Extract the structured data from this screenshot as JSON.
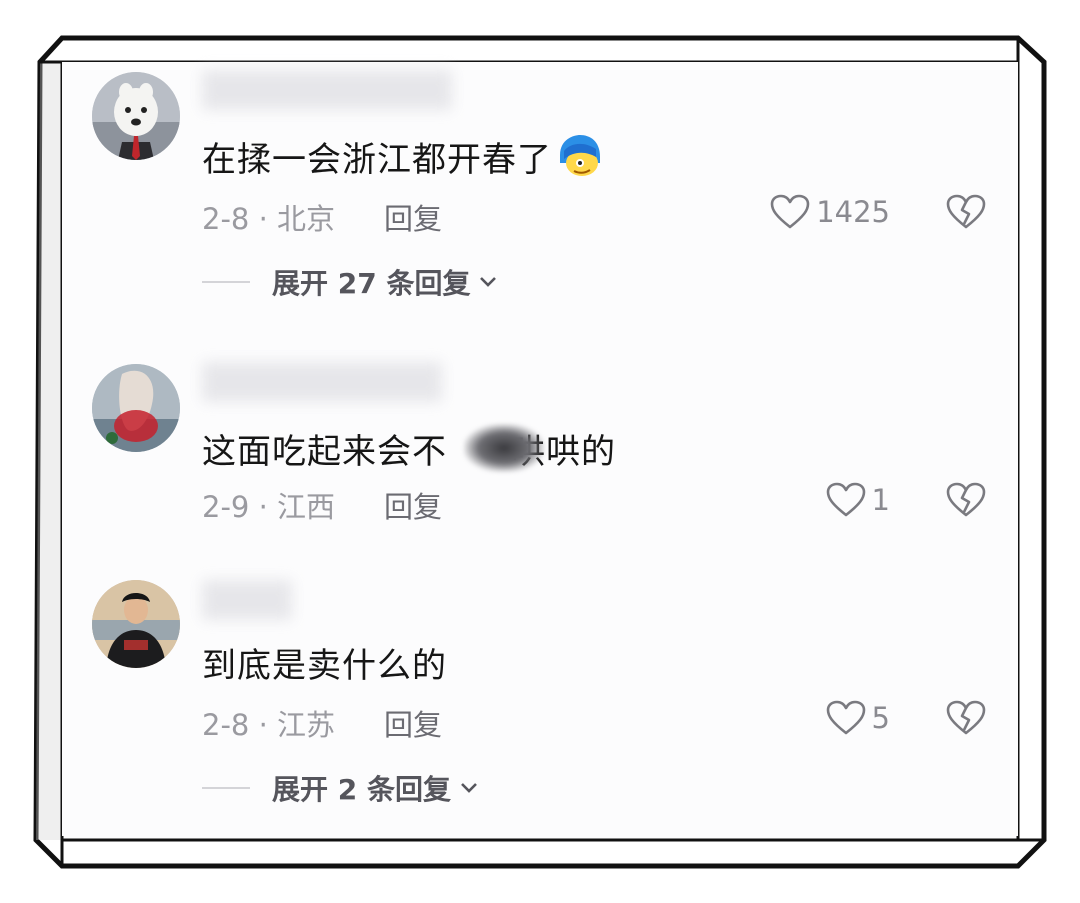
{
  "comments": [
    {
      "text": "在揉一会浙江都开春了",
      "date_loc": "2-8 · 北京",
      "reply_label": "回复",
      "likes": "1425",
      "expand_label": "展开 27 条回复"
    },
    {
      "text_before": "这面吃起来会不",
      "text_after": "哄哄的",
      "date_loc": "2-9 · 江西",
      "reply_label": "回复",
      "likes": "1"
    },
    {
      "text": "到底是卖什么的",
      "date_loc": "2-8 · 江苏",
      "reply_label": "回复",
      "likes": "5",
      "expand_label": "展开 2 条回复"
    }
  ],
  "icons": {
    "like": "heart-outline-icon",
    "dislike": "broken-heart-icon",
    "expand": "chevron-down-icon",
    "emoji": "blue-hair-face-emoji"
  },
  "colors": {
    "text": "#161616",
    "meta": "#9a9aa0",
    "frame": "#111111"
  }
}
